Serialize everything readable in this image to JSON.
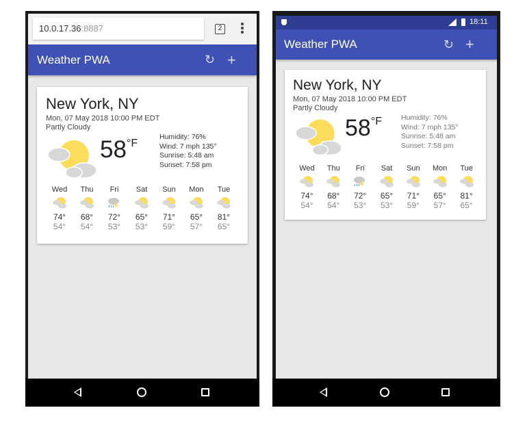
{
  "browser": {
    "url_host": "10.0.17.36",
    "url_port": ":8887",
    "tab_count": "2"
  },
  "statusbar": {
    "time": "18:11"
  },
  "app": {
    "title": "Weather PWA",
    "refresh_icon": "↻",
    "add_icon": "+"
  },
  "weather": {
    "location": "New York, NY",
    "date": "Mon, 07 May 2018 10:00 PM EDT",
    "description": "Partly Cloudy",
    "temperature": "58",
    "unit": "°F",
    "humidity_label": "Humidity: ",
    "humidity": "76%",
    "wind_label": "Wind: ",
    "wind": "7 mph 135°",
    "sunrise_label": "Sunrise: ",
    "sunrise": "5:48 am",
    "sunset_label": "Sunset: ",
    "sunset": "7:58 pm",
    "forecast": [
      {
        "day": "Wed",
        "high": "74°",
        "low": "54°",
        "icon": "partly-cloudy-icon"
      },
      {
        "day": "Thu",
        "high": "68°",
        "low": "54°",
        "icon": "partly-cloudy-icon"
      },
      {
        "day": "Fri",
        "high": "72°",
        "low": "53°",
        "icon": "thunderstorm-icon"
      },
      {
        "day": "Sat",
        "high": "65°",
        "low": "53°",
        "icon": "partly-cloudy-icon"
      },
      {
        "day": "Sun",
        "high": "71°",
        "low": "59°",
        "icon": "partly-cloudy-icon"
      },
      {
        "day": "Mon",
        "high": "65°",
        "low": "57°",
        "icon": "partly-cloudy-icon"
      },
      {
        "day": "Tue",
        "high": "81°",
        "low": "65°",
        "icon": "partly-cloudy-icon"
      }
    ]
  },
  "colors": {
    "appbar": "#3f51b5",
    "statusbar": "#2f3e93",
    "sun": "#fddc5c",
    "cloud": "#d8d8d8"
  }
}
